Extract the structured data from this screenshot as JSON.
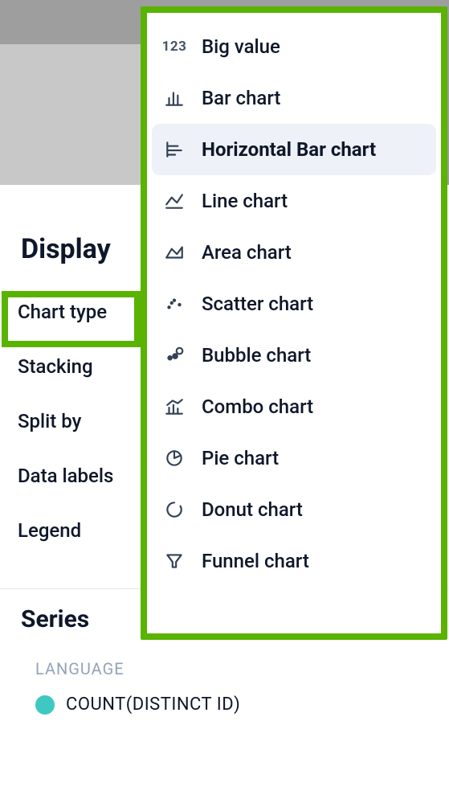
{
  "display": {
    "title": "Display",
    "items": {
      "chart_type": "Chart type",
      "stacking": "Stacking",
      "split_by": "Split by",
      "data_labels": "Data labels",
      "legend": "Legend"
    }
  },
  "chart_types": {
    "selected_index": 2,
    "options": [
      {
        "key": "big-value",
        "label": "Big value",
        "icon": "123"
      },
      {
        "key": "bar",
        "label": "Bar chart",
        "icon": "bar"
      },
      {
        "key": "hbar",
        "label": "Horizontal Bar chart",
        "icon": "hbar"
      },
      {
        "key": "line",
        "label": "Line chart",
        "icon": "line"
      },
      {
        "key": "area",
        "label": "Area chart",
        "icon": "area"
      },
      {
        "key": "scatter",
        "label": "Scatter chart",
        "icon": "scatter"
      },
      {
        "key": "bubble",
        "label": "Bubble chart",
        "icon": "bubble"
      },
      {
        "key": "combo",
        "label": "Combo chart",
        "icon": "combo"
      },
      {
        "key": "pie",
        "label": "Pie chart",
        "icon": "pie"
      },
      {
        "key": "donut",
        "label": "Donut chart",
        "icon": "donut"
      },
      {
        "key": "funnel",
        "label": "Funnel chart",
        "icon": "funnel"
      }
    ]
  },
  "series": {
    "title": "Series",
    "summary": "COUNT(DISTINCT ID)",
    "group_label": "LANGUAGE",
    "value": "COUNT(DISTINCT ID)",
    "swatch_color": "#3ec8c2"
  }
}
